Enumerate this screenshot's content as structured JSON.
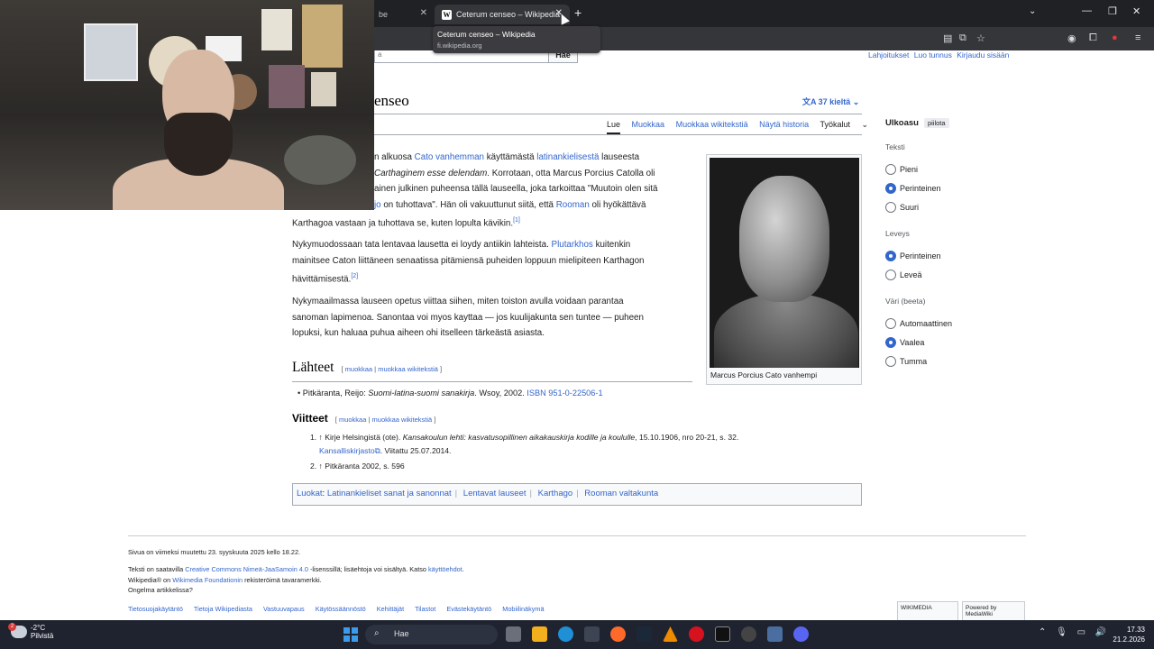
{
  "browser": {
    "prev_tab_title": "be",
    "active_tab_title": "Ceterum censeo – Wikipedia",
    "tooltip_title": "Ceterum censeo – Wikipedia",
    "tooltip_url": "fi.wikipedia.org",
    "new_tab_label": "+",
    "close_glyph": "✕"
  },
  "wiki": {
    "search_placeholder": "a",
    "search_button": "Hae",
    "user_links": [
      "Lahjoitukset",
      "Luo tunnus",
      "Kirjaudu sisään"
    ],
    "title_visible": "enseo",
    "languages": "37 kieltä",
    "tabs": [
      "Lue",
      "Muokkaa",
      "Muokkaa wikitekstiä",
      "Näytä historia",
      "Työkalut"
    ],
    "para1": {
      "l1_a": "n alkuosa ",
      "l1_link1": "Cato vanhemman",
      "l1_b": " käyttämästä ",
      "l1_link2": "latinankielisestä",
      "l1_c": " lauseesta",
      "l2_italic": "Carthaginem esse delendam",
      "l2_b": ". Korrotaan, otta Marcus Porcius Catolla oli",
      "l3": "ainen julkinen puheensa tällä lauseella, joka tarkoittaa \"Muutoin olen sitä",
      "l4_link": "jo",
      "l4_b": " on tuhottava\". Hän oli vakuuttunut siitä, että ",
      "l4_link2": "Rooman",
      "l4_c": " oli hyökättävä",
      "l5": "Karthagoa vastaan ja tuhottava se, kuten lopulta kävikin.",
      "l5_ref": "[1]"
    },
    "para2": {
      "l1_a": "Nykymuodossaan tata lentavaa lausetta ei loydy antiikin lahteista. ",
      "l1_link": "Plutarkhos",
      "l1_b": " kuitenkin",
      "l2": "mainitsee Caton liittäneen senaatissa pitämiensä puheiden loppuun mielipiteen Karthagon",
      "l3": "hävittämisestä.",
      "l3_ref": "[2]"
    },
    "para3": {
      "l1": "Nykymaailmassa lauseen opetus viittaa siihen, miten toiston avulla voidaan parantaa",
      "l2": "sanoman lapimenoa. Sanontaa voi myos kayttaa — jos kuulijakunta sen tuntee — puheen",
      "l3": "lopuksi, kun haluaa puhua aiheen ohi itselleen tärkeästä asiasta."
    },
    "image_caption": "Marcus Porcius Cato vanhempi",
    "sources_heading": "Lähteet",
    "edit_link1": "muokkaa",
    "edit_link2": "muokkaa wikitekstiä",
    "source_item_a": "Pitkäranta, Reijo: ",
    "source_item_italic": "Suomi-latina-suomi sanakirja",
    "source_item_b": ". Wsoy, 2002. ",
    "source_isbn": "ISBN 951-0-22506-1",
    "refs_heading": "Viitteet",
    "ref1_a": "1. ↑ Kirje Helsingistä (ote). ",
    "ref1_italic": "Kansakoulun lehti: kasvatusopillinen aikakauskirja kodille ja koululle",
    "ref1_b": ", 15.10.1906, nro 20-21, s. 32.",
    "ref1_link": "Kansalliskirjasto",
    "ref1_c": ". Viitattu 25.07.2014.",
    "ref2": "2. ↑ Pitkäranta 2002, s. 596",
    "categories_label": "Luokat",
    "categories": [
      "Latinankieliset sanat ja sanonnat",
      "Lentavat lauseet",
      "Karthago",
      "Rooman valtakunta"
    ],
    "footer_modified": "Sivua on viimeksi muutettu 23. syyskuuta 2025 kello 18.22.",
    "footer_license_a": "Teksti on saatavilla ",
    "footer_license_link": "Creative Commons Nimeä-JaaSamoin 4.0",
    "footer_license_b": " -lisenssillä; lisäehtoja voi sisältyä. Katso ",
    "footer_license_link2": "käyttöehdot",
    "footer_trademark_a": "Wikipedia® on ",
    "footer_trademark_link": "Wikimedia Foundationin",
    "footer_trademark_b": " rekisteröimä tavaramerkki.",
    "footer_problem": "Ongelma artikkelissa?",
    "footer_links": [
      "Tietosuojakäytäntö",
      "Tietoja Wikipediasta",
      "Vastuuvapaus",
      "Käytössäännöstö",
      "Kehittäjät",
      "Tilastot",
      "Evästekäytäntö",
      "Mobiilinäkymä"
    ],
    "badge1": "WIKIMEDIA",
    "badge2": "Powered by MediaWiki"
  },
  "appearance": {
    "title": "Ulkoasu",
    "hide": "piilota",
    "text_label": "Teksti",
    "text_options": [
      "Pieni",
      "Perinteinen",
      "Suuri"
    ],
    "text_selected": 1,
    "width_label": "Leveys",
    "width_options": [
      "Perinteinen",
      "Leveä"
    ],
    "width_selected": 0,
    "color_label": "Väri (beeta)",
    "color_options": [
      "Automaattinen",
      "Vaalea",
      "Tumma"
    ],
    "color_selected": 1
  },
  "taskbar": {
    "temperature": "-2°C",
    "weather": "Pilvistä",
    "search": "Hae",
    "time": "17.33",
    "date": "21.2.2026",
    "weather_badge": "2"
  },
  "colors": {
    "link": "#3366cc",
    "radio_selected": "#3366cc",
    "taskbar": "#1f2330"
  }
}
